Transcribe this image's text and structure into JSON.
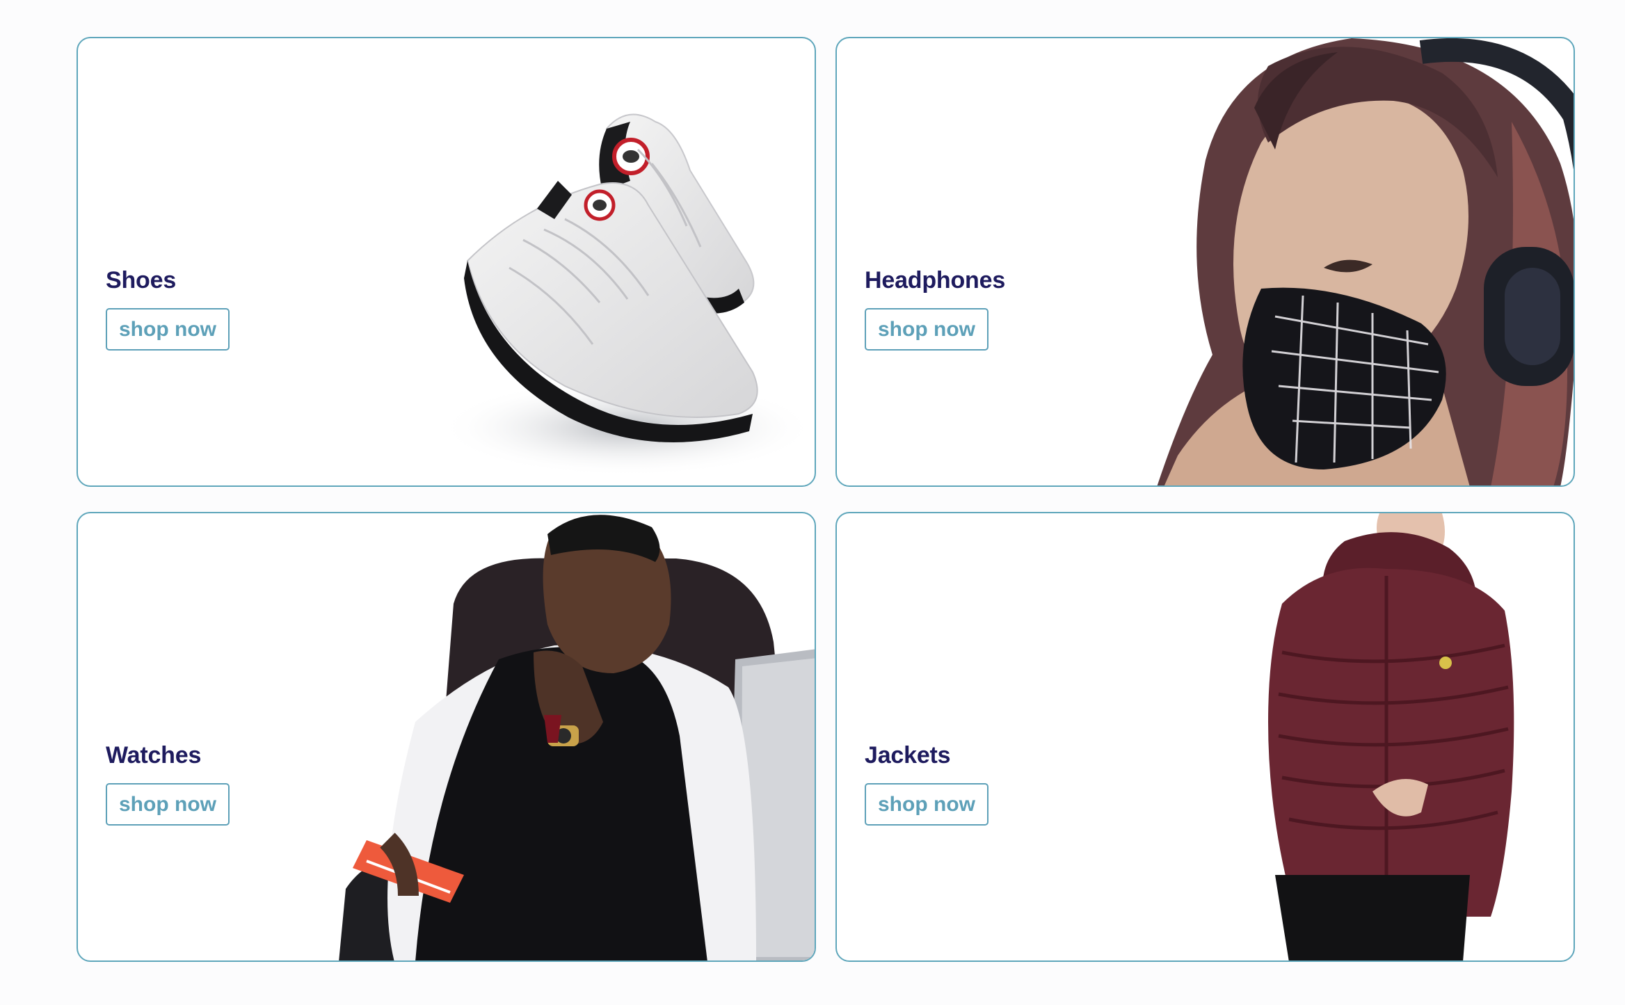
{
  "categories": [
    {
      "title": "Shoes",
      "button": "shop now",
      "image": "sneakers-image"
    },
    {
      "title": "Headphones",
      "button": "shop now",
      "image": "woman-headphones-mask-image"
    },
    {
      "title": "Watches",
      "button": "shop now",
      "image": "man-thinking-watch-image"
    },
    {
      "title": "Jackets",
      "button": "shop now",
      "image": "man-burgundy-jacket-image"
    }
  ],
  "colors": {
    "card_border": "#5ea6bb",
    "title": "#1e1b5e",
    "button": "#5da0b8"
  }
}
